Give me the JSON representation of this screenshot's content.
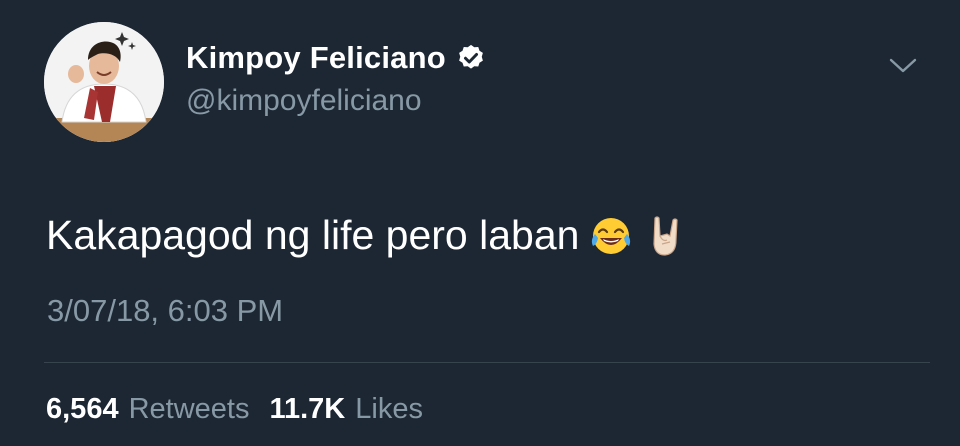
{
  "author": {
    "display_name": "Kimpoy Feliciano",
    "handle": "@kimpoyfeliciano",
    "verified": true,
    "avatar_icon": "profile-photo",
    "verified_icon": "verified-badge-icon"
  },
  "menu": {
    "icon": "chevron-down-icon"
  },
  "tweet": {
    "text": "Kakapagod ng life pero laban",
    "emojis": [
      "face-with-tears-of-joy",
      "sign-of-the-horns"
    ],
    "timestamp": "3/07/18, 6:03 PM"
  },
  "stats": {
    "retweets_count": "6,564",
    "retweets_label": "Retweets",
    "likes_count": "11.7K",
    "likes_label": "Likes"
  },
  "colors": {
    "background": "#1c2733",
    "primary_text": "#ffffff",
    "secondary_text": "#8899a6",
    "divider": "#38444d"
  }
}
